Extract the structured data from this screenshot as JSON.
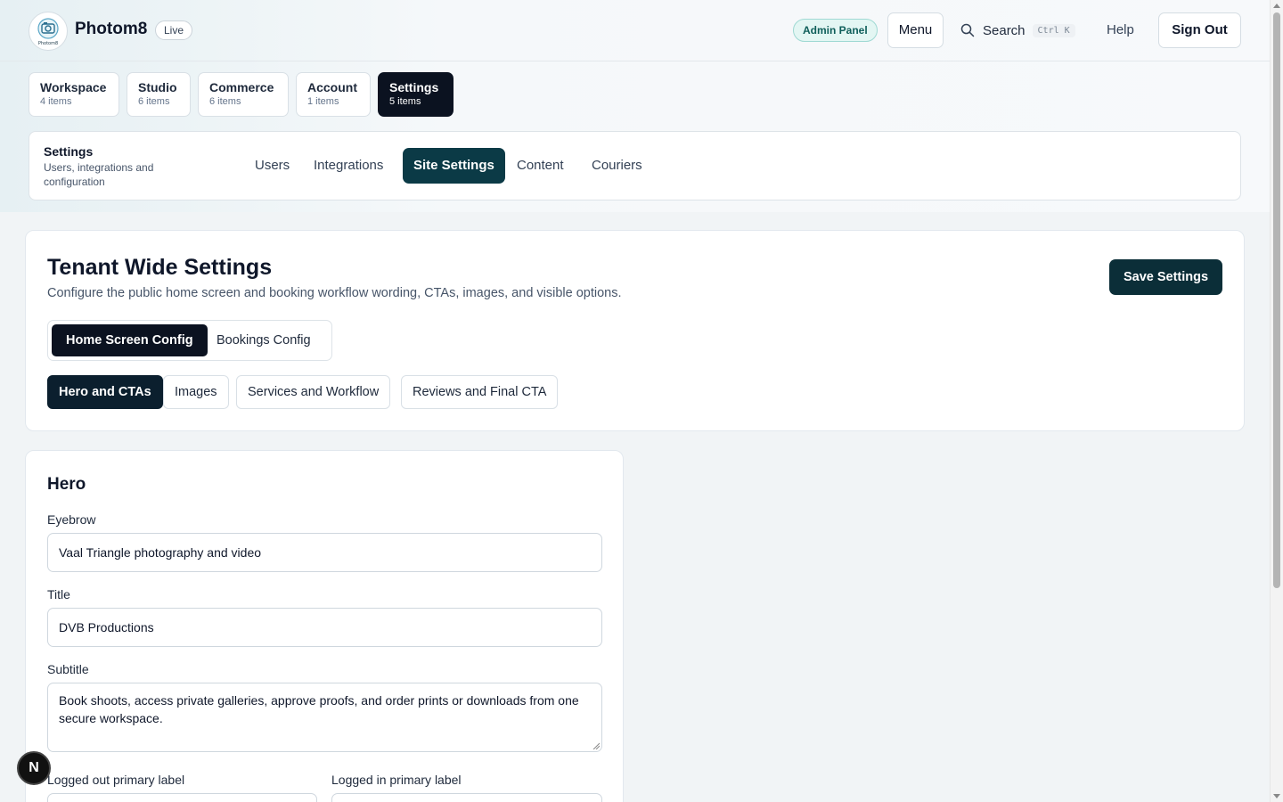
{
  "header": {
    "brand": "Photom8",
    "logo_text": "Photom8",
    "status_badge": "Live",
    "admin_badge": "Admin Panel",
    "menu_label": "Menu",
    "search_label": "Search",
    "search_shortcut": "Ctrl K",
    "help_label": "Help",
    "signout_label": "Sign Out"
  },
  "groups": [
    {
      "title": "Workspace",
      "count": "4 items"
    },
    {
      "title": "Studio",
      "count": "6 items"
    },
    {
      "title": "Commerce",
      "count": "6 items"
    },
    {
      "title": "Account",
      "count": "1 items"
    },
    {
      "title": "Settings",
      "count": "5 items",
      "active": true
    }
  ],
  "subnav": {
    "title": "Settings",
    "description": "Users, integrations and configuration",
    "items": [
      {
        "label": "Users"
      },
      {
        "label": "Integrations"
      },
      {
        "label": "Site Settings",
        "active": true
      },
      {
        "label": "Content"
      },
      {
        "label": "Couriers"
      }
    ]
  },
  "page": {
    "title": "Tenant Wide Settings",
    "description": "Configure the public home screen and booking workflow wording, CTAs, images, and visible options.",
    "save_label": "Save Settings",
    "config_tabs": [
      {
        "label": "Home Screen Config",
        "active": true
      },
      {
        "label": "Bookings Config"
      }
    ],
    "section_tabs": [
      {
        "label": "Hero and CTAs",
        "active": true
      },
      {
        "label": "Images"
      },
      {
        "label": "Services and Workflow"
      },
      {
        "label": "Reviews and Final CTA"
      }
    ]
  },
  "hero": {
    "section_title": "Hero",
    "eyebrow_label": "Eyebrow",
    "eyebrow_value": "Vaal Triangle photography and video",
    "title_label": "Title",
    "title_value": "DVB Productions",
    "subtitle_label": "Subtitle",
    "subtitle_value": "Book shoots, access private galleries, approve proofs, and order prints or downloads from one secure workspace.",
    "logged_out_primary_label": "Logged out primary label",
    "logged_in_primary_label": "Logged in primary label"
  },
  "dev_badge": "N",
  "colors": {
    "primary_dark": "#0b1220",
    "accent_teal": "#0b3a46",
    "admin_badge_bg": "#e3f6f3"
  }
}
